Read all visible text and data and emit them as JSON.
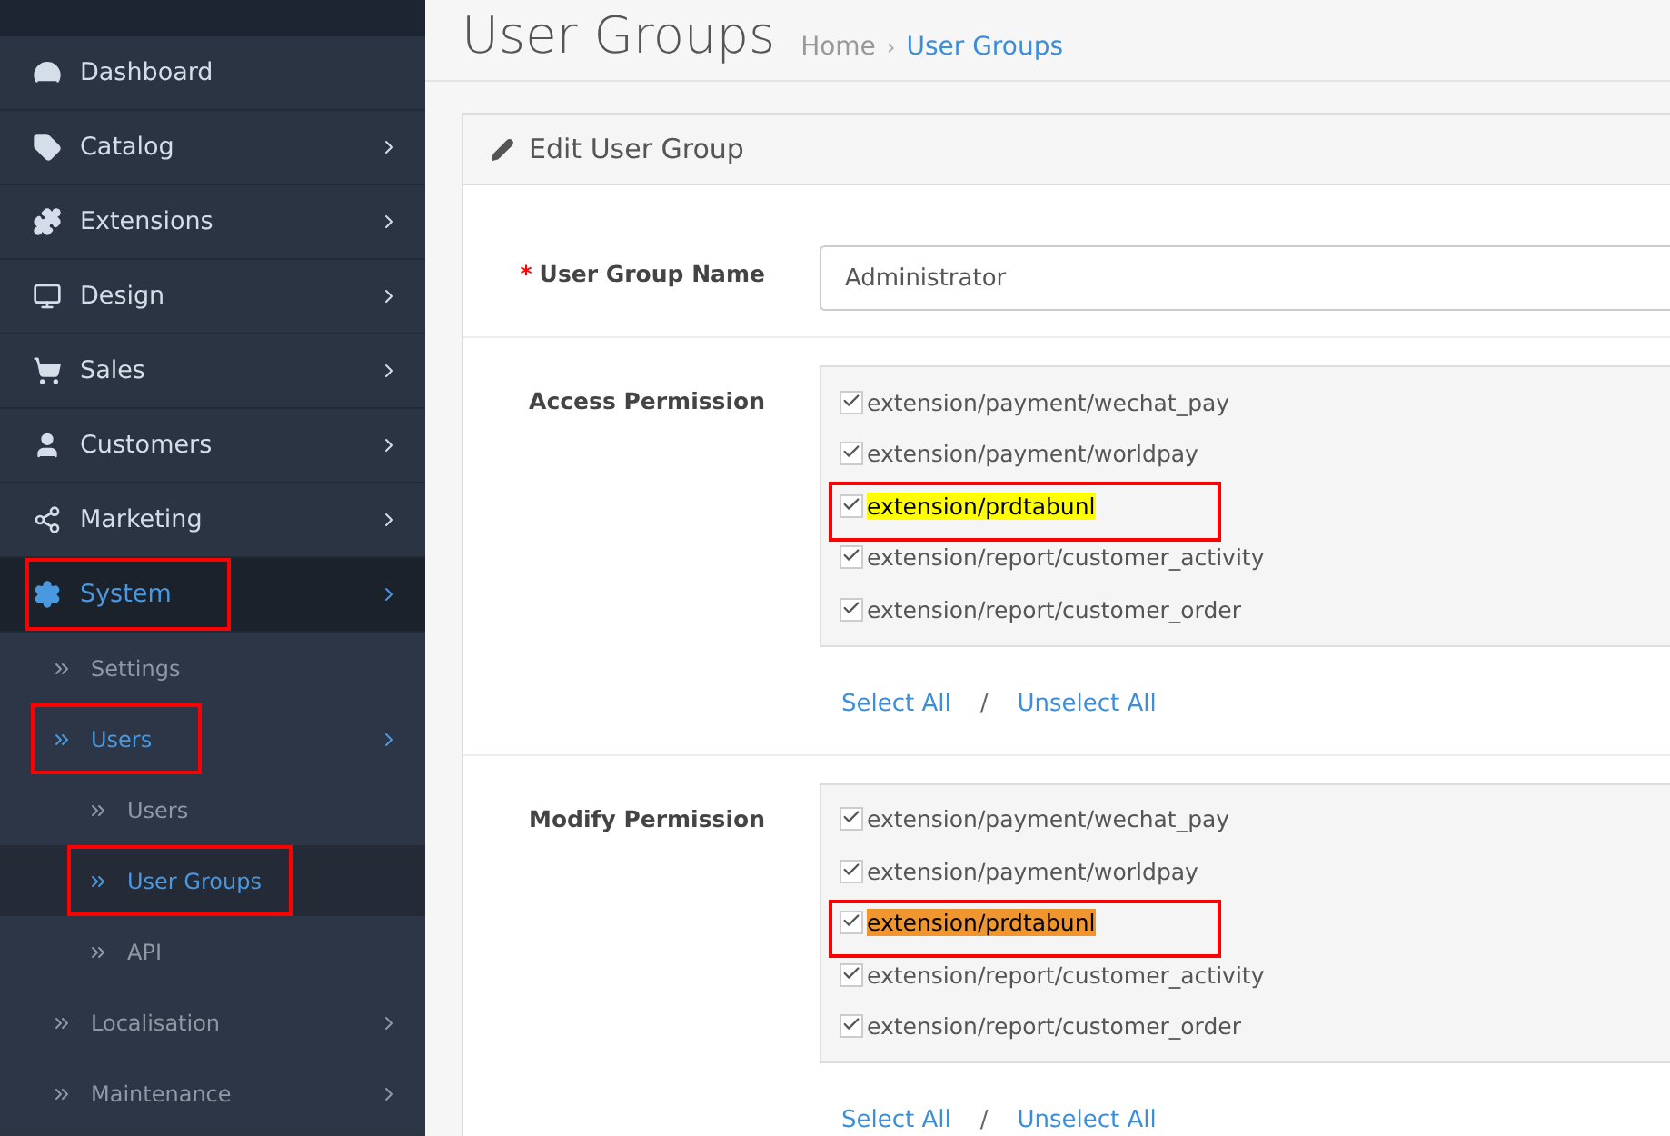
{
  "sidebar": {
    "items": [
      {
        "label": "Dashboard",
        "selected": false,
        "annotated": false,
        "has_children": false
      },
      {
        "label": "Catalog",
        "selected": false,
        "annotated": false,
        "has_children": true
      },
      {
        "label": "Extensions",
        "selected": false,
        "annotated": false,
        "has_children": true
      },
      {
        "label": "Design",
        "selected": false,
        "annotated": false,
        "has_children": true
      },
      {
        "label": "Sales",
        "selected": false,
        "annotated": false,
        "has_children": true
      },
      {
        "label": "Customers",
        "selected": false,
        "annotated": false,
        "has_children": true
      },
      {
        "label": "Marketing",
        "selected": false,
        "annotated": false,
        "has_children": true
      },
      {
        "label": "System",
        "selected": true,
        "annotated": true,
        "has_children": true,
        "children": [
          {
            "label": "Settings",
            "selected": false,
            "annotated": false,
            "has_children": false
          },
          {
            "label": "Users",
            "selected": true,
            "annotated": true,
            "has_children": true,
            "children": [
              {
                "label": "Users",
                "selected": false,
                "annotated": false,
                "has_children": false
              },
              {
                "label": "User Groups",
                "selected": true,
                "annotated": true,
                "has_children": false
              },
              {
                "label": "API",
                "selected": false,
                "annotated": false,
                "has_children": false
              }
            ]
          },
          {
            "label": "Localisation",
            "selected": false,
            "annotated": false,
            "has_children": true
          },
          {
            "label": "Maintenance",
            "selected": false,
            "annotated": false,
            "has_children": true
          }
        ]
      }
    ]
  },
  "page": {
    "title": "User Groups",
    "breadcrumb": [
      {
        "label": "Home",
        "selected": false
      },
      {
        "label": "User Groups",
        "selected": true
      }
    ],
    "separator": "›"
  },
  "panel": {
    "title": "Edit User Group",
    "name_field": {
      "label": "User Group Name",
      "required_mark": "*",
      "value": "Administrator"
    },
    "permissions": [
      {
        "label": "Access Permission",
        "items": [
          {
            "label": "extension/payment/wechat_pay",
            "checked": true,
            "annotated": false
          },
          {
            "label": "extension/payment/worldpay",
            "checked": true,
            "annotated": false
          },
          {
            "label": "extension/prdtabunl",
            "checked": true,
            "annotated": true,
            "color": "#ffff00"
          },
          {
            "label": "extension/report/customer_activity",
            "checked": true,
            "annotated": false
          },
          {
            "label": "extension/report/customer_order",
            "checked": true,
            "annotated": false
          }
        ],
        "select_all": "Select All",
        "divider": "/",
        "unselect_all": "Unselect All"
      },
      {
        "label": "Modify Permission",
        "items": [
          {
            "label": "extension/payment/wechat_pay",
            "checked": true,
            "annotated": false
          },
          {
            "label": "extension/payment/worldpay",
            "checked": true,
            "annotated": false
          },
          {
            "label": "extension/prdtabunl",
            "checked": true,
            "annotated": true,
            "color": "#f0962e"
          },
          {
            "label": "extension/report/customer_activity",
            "checked": true,
            "annotated": false
          },
          {
            "label": "extension/report/customer_order",
            "checked": true,
            "annotated": false
          }
        ],
        "select_all": "Select All",
        "divider": "/",
        "unselect_all": "Unselect All"
      }
    ]
  }
}
